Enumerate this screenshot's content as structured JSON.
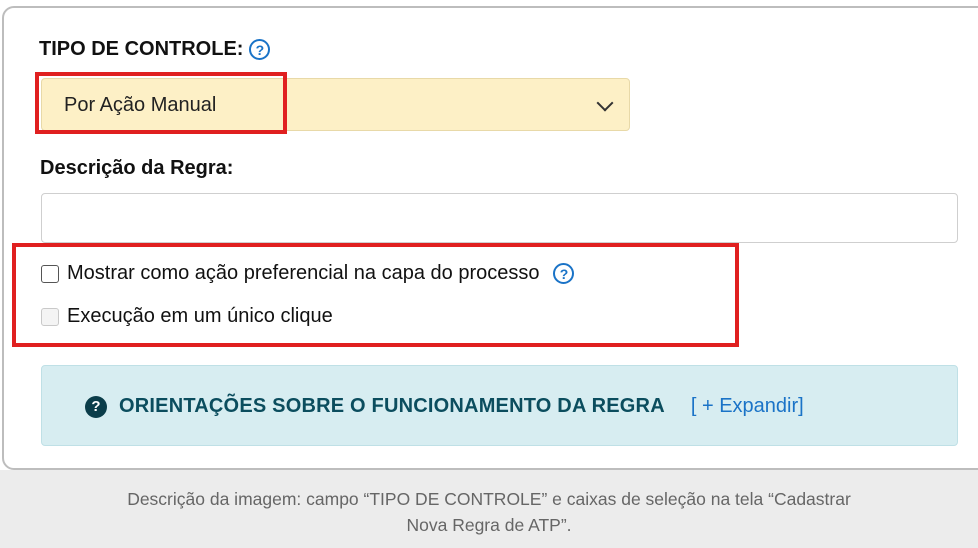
{
  "tipo_controle": {
    "label": "TIPO DE CONTROLE:",
    "help_icon": "question-circle-icon",
    "selected_value": "Por Ação Manual"
  },
  "descricao": {
    "label": "Descrição da Regra:",
    "value": ""
  },
  "checkboxes": [
    {
      "label": "Mostrar como ação preferencial na capa do processo",
      "checked": false,
      "enabled": true,
      "help_icon": "question-circle-icon"
    },
    {
      "label": "Execução em um único clique",
      "checked": false,
      "enabled": false
    }
  ],
  "orientacoes": {
    "icon": "question-circle-filled-icon",
    "title": "ORIENTAÇÕES SOBRE O FUNCIONAMENTO DA REGRA",
    "expand_label": "[ + Expandir]"
  },
  "caption": {
    "line1": "Descrição da imagem: campo “TIPO DE CONTROLE” e caixas de seleção na tela “Cadastrar",
    "line2": "Nova Regra de ATP”."
  },
  "colors": {
    "select_bg": "#fdf0c6",
    "highlight_red": "#e02020",
    "info_bg": "#d7edf1",
    "link_blue": "#1a73c7"
  }
}
